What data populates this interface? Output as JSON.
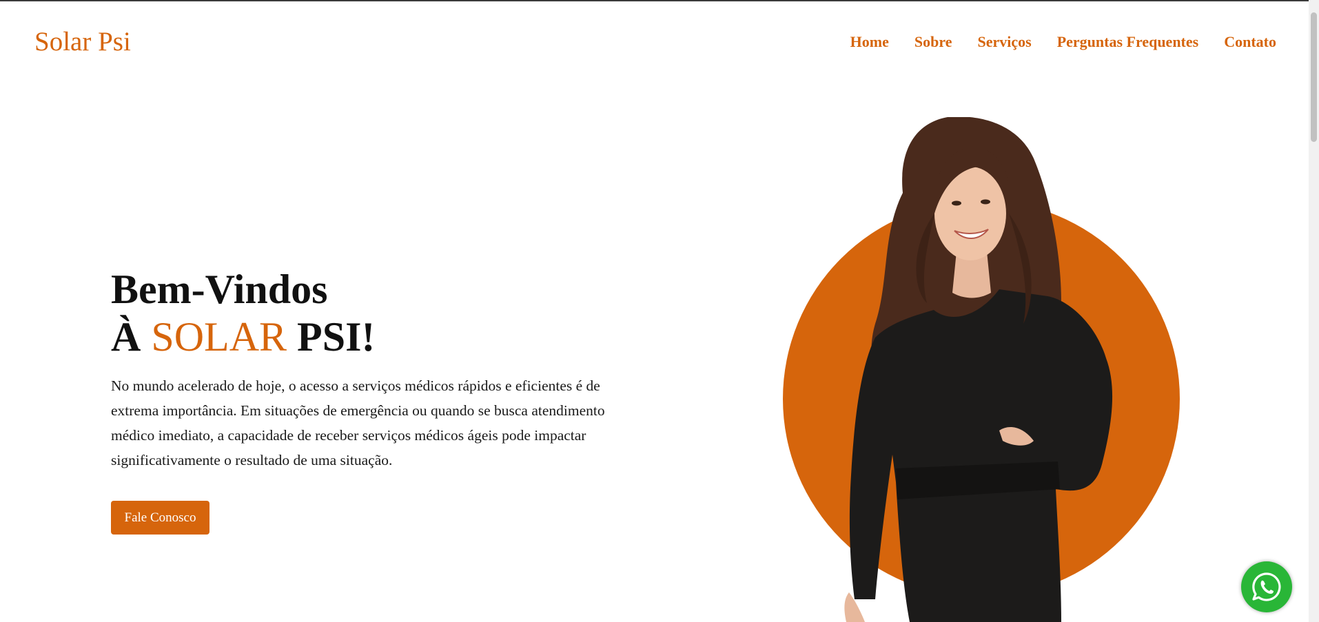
{
  "brand": {
    "logo_text": "Solar Psi",
    "accent_color": "#d6650c"
  },
  "nav": {
    "items": [
      {
        "label": "Home"
      },
      {
        "label": "Sobre"
      },
      {
        "label": "Serviços"
      },
      {
        "label": "Perguntas Frequentes"
      },
      {
        "label": "Contato"
      }
    ]
  },
  "hero": {
    "title_line1": "Bem-Vindos",
    "title_prefix": "À ",
    "title_accent": "SOLAR",
    "title_suffix": " PSI!",
    "description": "No mundo acelerado de hoje, o acesso a serviços médicos rápidos e eficientes é de extrema importância. Em situações de emergência ou quando se busca atendimento médico imediato, a capacidade de receber serviços médicos ágeis pode impactar significativamente o resultado de uma situação.",
    "cta_label": "Fale Conosco"
  },
  "floating": {
    "whatsapp_icon": "whatsapp-icon",
    "whatsapp_color": "#29b637"
  }
}
